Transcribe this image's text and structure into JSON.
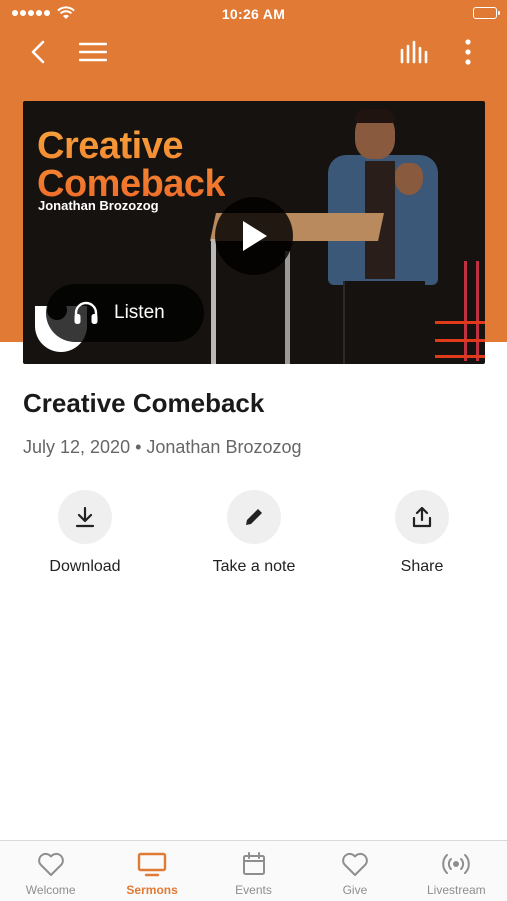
{
  "status_bar": {
    "time": "10:26 AM"
  },
  "header": {
    "back_icon": "chevron-left-icon",
    "menu_icon": "hamburger-icon",
    "audio_icon": "audio-bars-icon",
    "more_icon": "more-vertical-icon"
  },
  "hero": {
    "title_line1": "Creative",
    "title_line2": "Comeback",
    "speaker": "Jonathan Brozozog",
    "listen_label": "Listen"
  },
  "sermon": {
    "title": "Creative Comeback",
    "meta": "July 12, 2020 • Jonathan Brozozog"
  },
  "actions": [
    {
      "label": "Download",
      "icon": "download-icon"
    },
    {
      "label": "Take a note",
      "icon": "pencil-icon"
    },
    {
      "label": "Share",
      "icon": "share-icon"
    }
  ],
  "tabs": [
    {
      "label": "Welcome",
      "icon": "heart-icon",
      "active": false
    },
    {
      "label": "Sermons",
      "icon": "tv-icon",
      "active": true
    },
    {
      "label": "Events",
      "icon": "calendar-icon",
      "active": false
    },
    {
      "label": "Give",
      "icon": "heart-icon",
      "active": false
    },
    {
      "label": "Livestream",
      "icon": "broadcast-icon",
      "active": false
    }
  ],
  "colors": {
    "accent": "#e17a35",
    "tab_inactive": "#8e8e8e",
    "action_bg": "#efefef"
  }
}
